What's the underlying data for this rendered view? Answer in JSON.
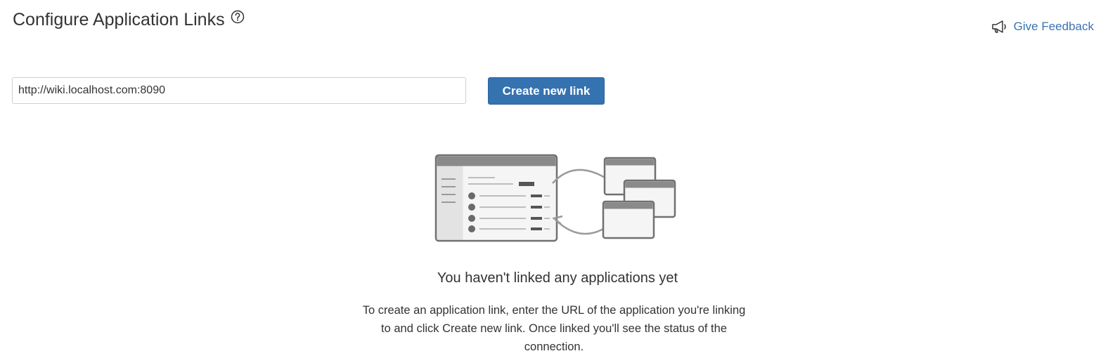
{
  "header": {
    "title": "Configure Application Links",
    "help_icon": "question-circle-icon",
    "feedback_label": "Give Feedback",
    "feedback_icon": "megaphone-icon"
  },
  "link_form": {
    "url_value": "http://wiki.localhost.com:8090",
    "create_button_label": "Create new link",
    "button_color": "#3572b0"
  },
  "empty_state": {
    "illustration": "linked-applications-illustration",
    "heading": "You haven't linked any applications yet",
    "description": "To create an application link, enter the URL of the application you're linking to and click Create new link. Once linked you'll see the status of the connection."
  }
}
